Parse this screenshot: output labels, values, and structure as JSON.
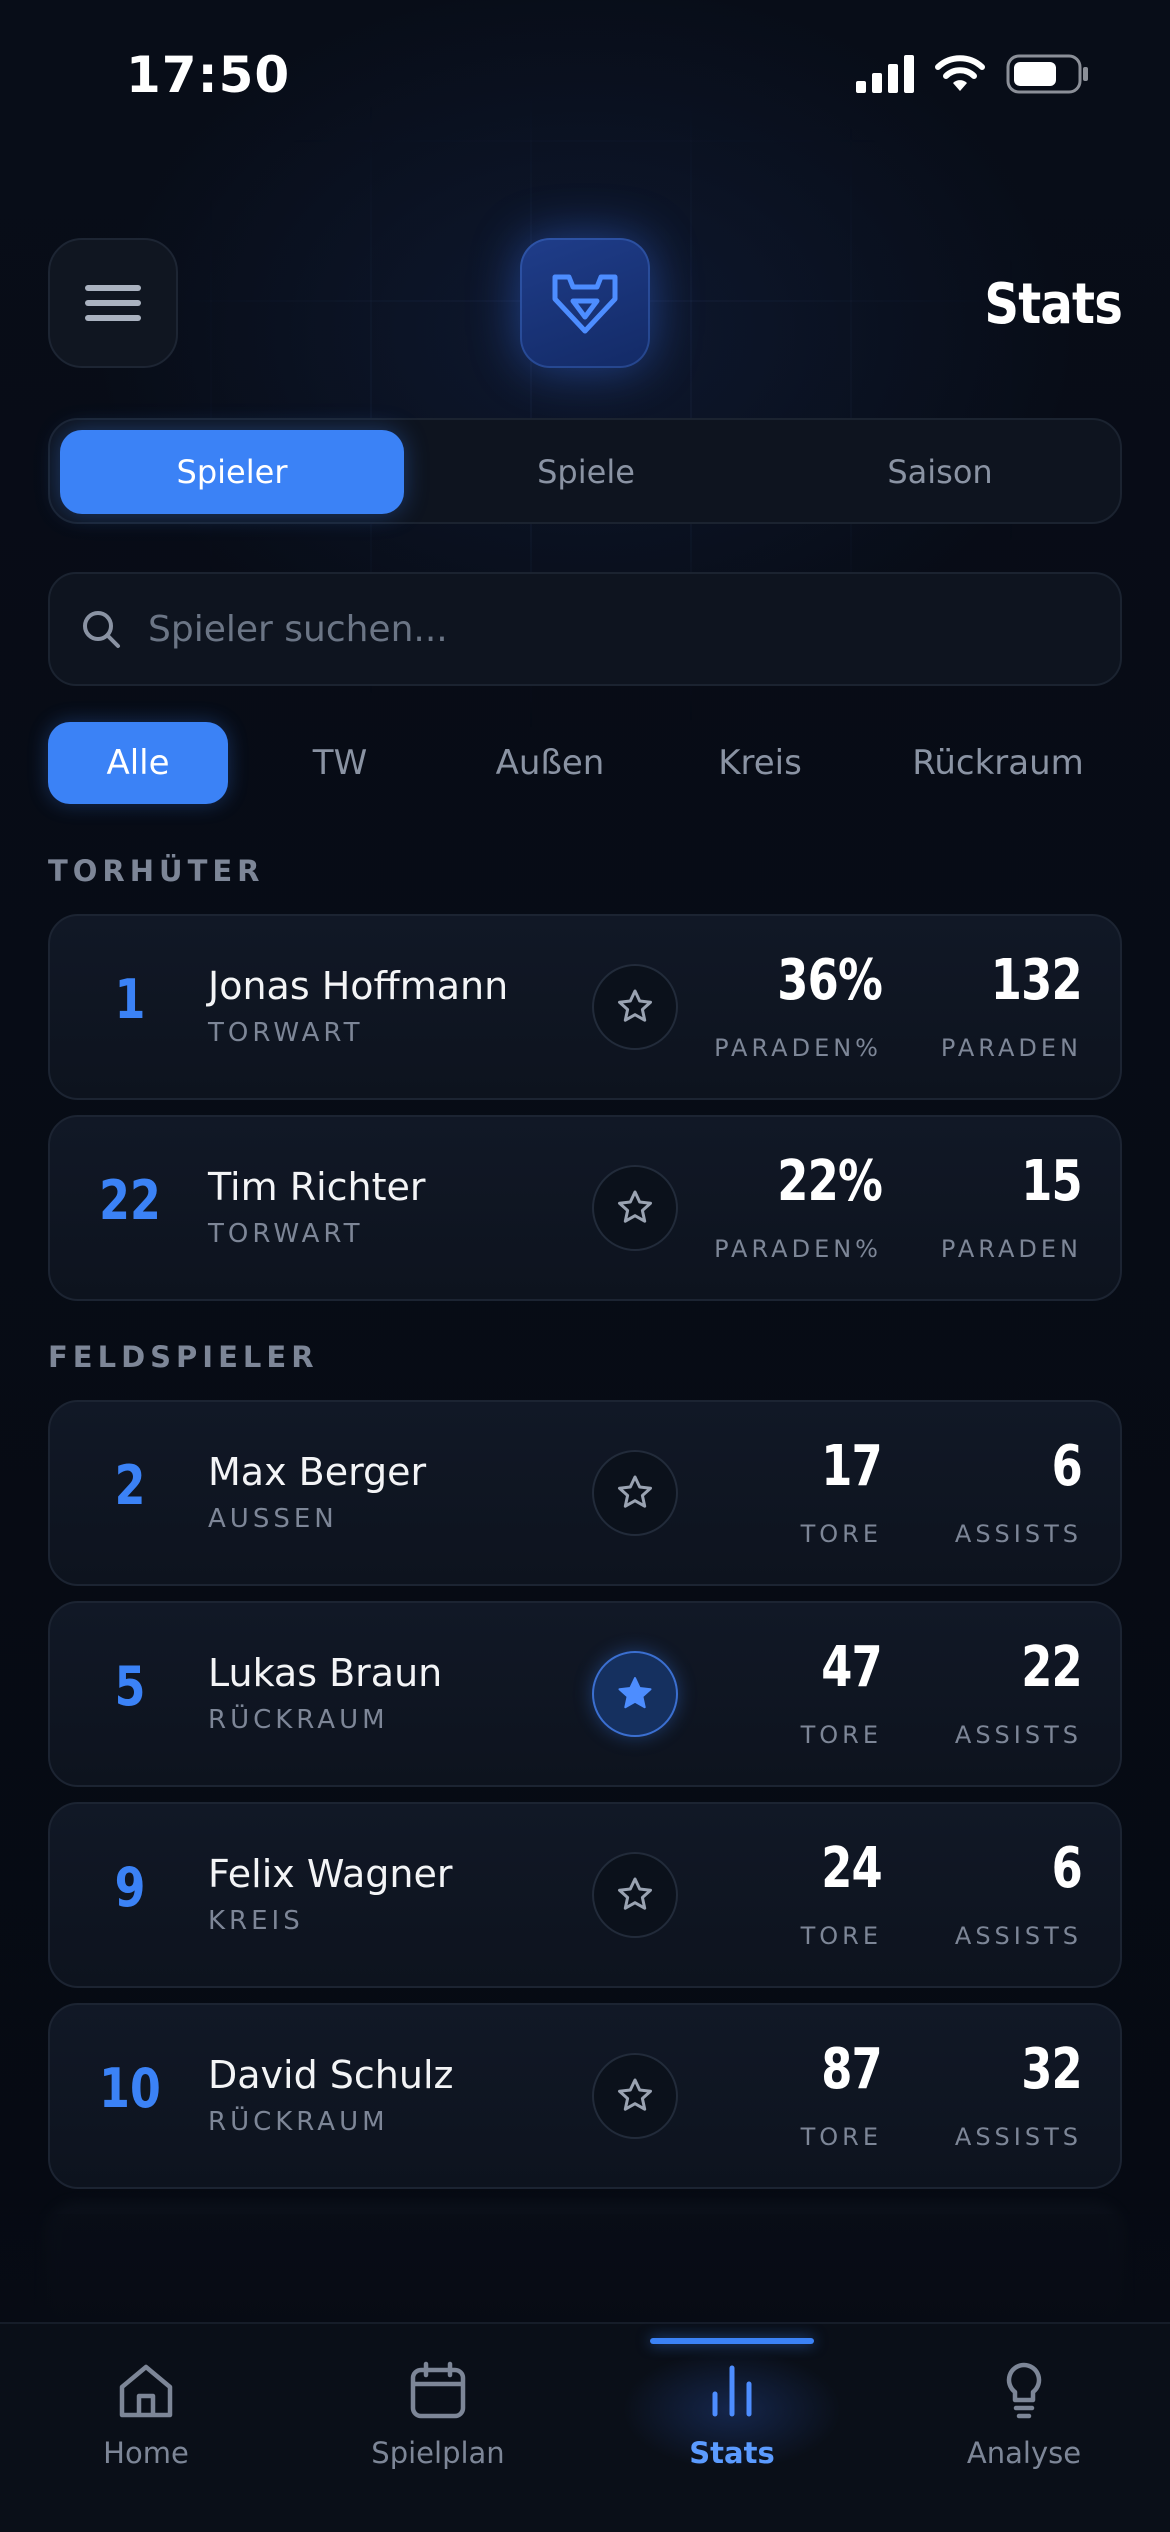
{
  "status_bar": {
    "time": "17:50"
  },
  "header": {
    "title": "Stats",
    "menu_icon": "hamburger-icon",
    "logo_icon": "shield-logo-icon"
  },
  "segments": [
    {
      "label": "Spieler",
      "active": true
    },
    {
      "label": "Spiele",
      "active": false
    },
    {
      "label": "Saison",
      "active": false
    }
  ],
  "search": {
    "placeholder": "Spieler suchen...",
    "value": ""
  },
  "filters": [
    {
      "label": "Alle",
      "active": true
    },
    {
      "label": "TW",
      "active": false
    },
    {
      "label": "Außen",
      "active": false
    },
    {
      "label": "Kreis",
      "active": false
    },
    {
      "label": "Rückraum",
      "active": false
    }
  ],
  "sections": {
    "goalkeepers": "TORHÜTER",
    "fieldplayers": "FELDSPIELER"
  },
  "goalkeepers": [
    {
      "number": "1",
      "name": "Jonas Hoffmann",
      "position": "TORWART",
      "favorite": false,
      "stat1_value": "36%",
      "stat1_label": "PARADEN%",
      "stat2_value": "132",
      "stat2_label": "PARADEN"
    },
    {
      "number": "22",
      "name": "Tim Richter",
      "position": "TORWART",
      "favorite": false,
      "stat1_value": "22%",
      "stat1_label": "PARADEN%",
      "stat2_value": "15",
      "stat2_label": "PARADEN"
    }
  ],
  "fieldplayers": [
    {
      "number": "2",
      "name": "Max Berger",
      "position": "AUSSEN",
      "favorite": false,
      "stat1_value": "17",
      "stat1_label": "TORE",
      "stat2_value": "6",
      "stat2_label": "ASSISTS"
    },
    {
      "number": "5",
      "name": "Lukas Braun",
      "position": "RÜCKRAUM",
      "favorite": true,
      "stat1_value": "47",
      "stat1_label": "TORE",
      "stat2_value": "22",
      "stat2_label": "ASSISTS"
    },
    {
      "number": "9",
      "name": "Felix Wagner",
      "position": "KREIS",
      "favorite": false,
      "stat1_value": "24",
      "stat1_label": "TORE",
      "stat2_value": "6",
      "stat2_label": "ASSISTS"
    },
    {
      "number": "10",
      "name": "David Schulz",
      "position": "RÜCKRAUM",
      "favorite": false,
      "stat1_value": "87",
      "stat1_label": "TORE",
      "stat2_value": "32",
      "stat2_label": "ASSISTS"
    }
  ],
  "tabs": [
    {
      "label": "Home",
      "icon": "home-icon",
      "active": false
    },
    {
      "label": "Spielplan",
      "icon": "calendar-icon",
      "active": false
    },
    {
      "label": "Stats",
      "icon": "bar-chart-icon",
      "active": true
    },
    {
      "label": "Analyse",
      "icon": "lightbulb-icon",
      "active": false
    }
  ],
  "colors": {
    "accent": "#3b82f6",
    "background": "#070b14",
    "card": "#111826",
    "muted": "#7d8697"
  }
}
